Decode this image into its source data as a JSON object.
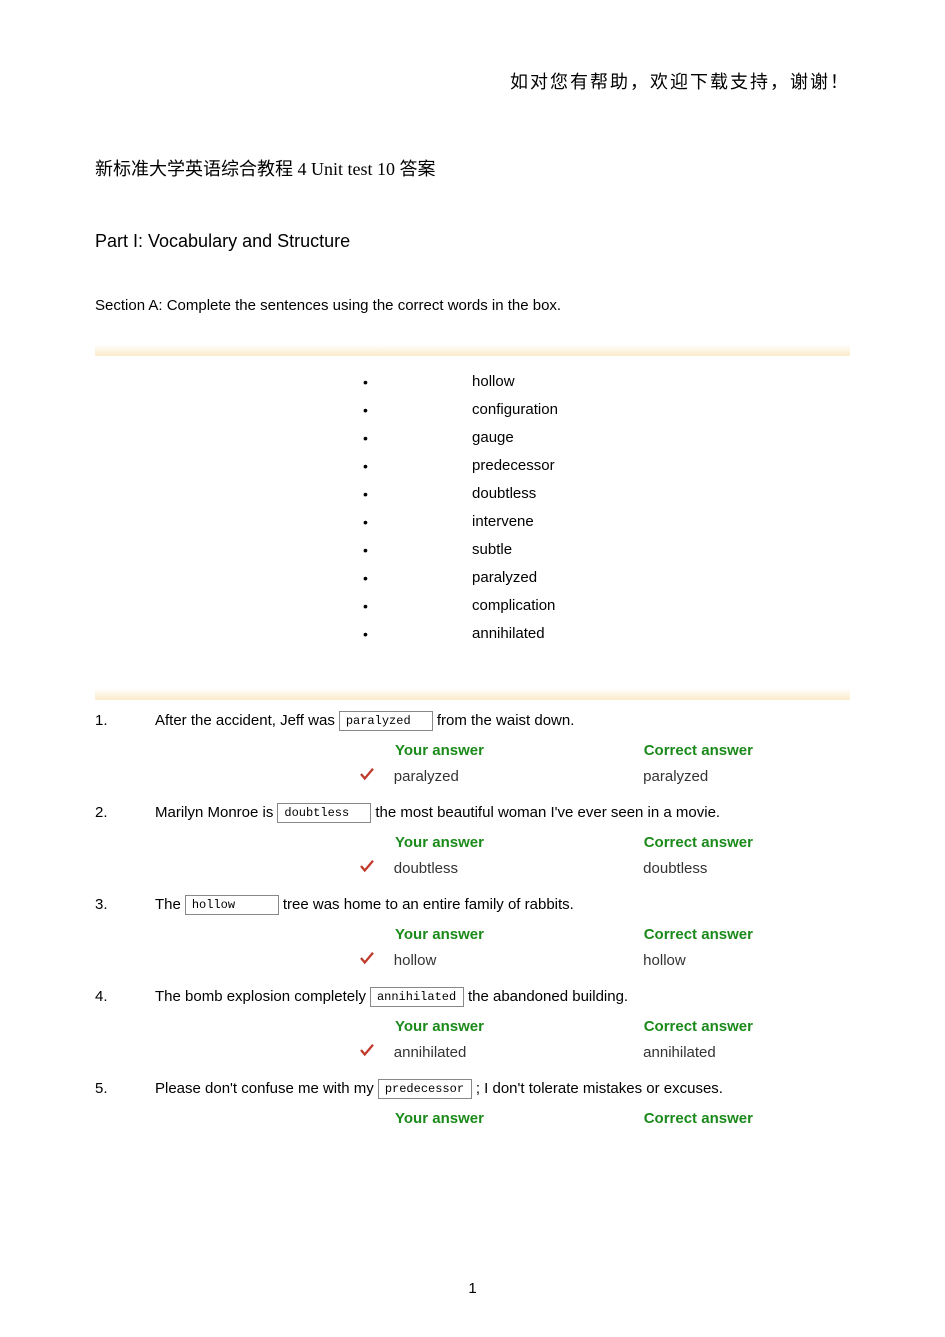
{
  "header_text": "如对您有帮助，欢迎下载支持，谢谢！",
  "doc_title": "新标准大学英语综合教程 4 Unit test 10 答案",
  "part_title": "Part I: Vocabulary and Structure",
  "section_text": "Section A: Complete the sentences using the correct words in the box.",
  "word_box": [
    "hollow",
    "configuration",
    "gauge",
    "predecessor",
    "doubtless",
    "intervene",
    "subtle",
    "paralyzed",
    "complication",
    "annihilated"
  ],
  "labels": {
    "your_answer": "Your answer",
    "correct_answer": "Correct answer"
  },
  "questions": [
    {
      "num": "1.",
      "pre": "After the accident, Jeff was",
      "boxed": "paralyzed",
      "post": "from the waist down.",
      "your": "paralyzed",
      "correct": "paralyzed",
      "show_values": true
    },
    {
      "num": "2.",
      "pre": "Marilyn Monroe is",
      "boxed": "doubtless",
      "post": "the most beautiful woman I've ever seen in a movie.",
      "your": "doubtless",
      "correct": "doubtless",
      "show_values": true
    },
    {
      "num": "3.",
      "pre": "The",
      "boxed": "hollow",
      "post": "tree was home to an entire family of rabbits.",
      "your": "hollow",
      "correct": "hollow",
      "show_values": true
    },
    {
      "num": "4.",
      "pre": "The bomb explosion completely",
      "boxed": "annihilated",
      "post": "the abandoned building.",
      "your": "annihilated",
      "correct": "annihilated",
      "show_values": true
    },
    {
      "num": "5.",
      "pre": "Please don't confuse me with my",
      "boxed": "predecessor",
      "post": "; I don't tolerate mistakes or excuses.",
      "your": "",
      "correct": "",
      "show_values": false
    }
  ],
  "page_number": "1"
}
